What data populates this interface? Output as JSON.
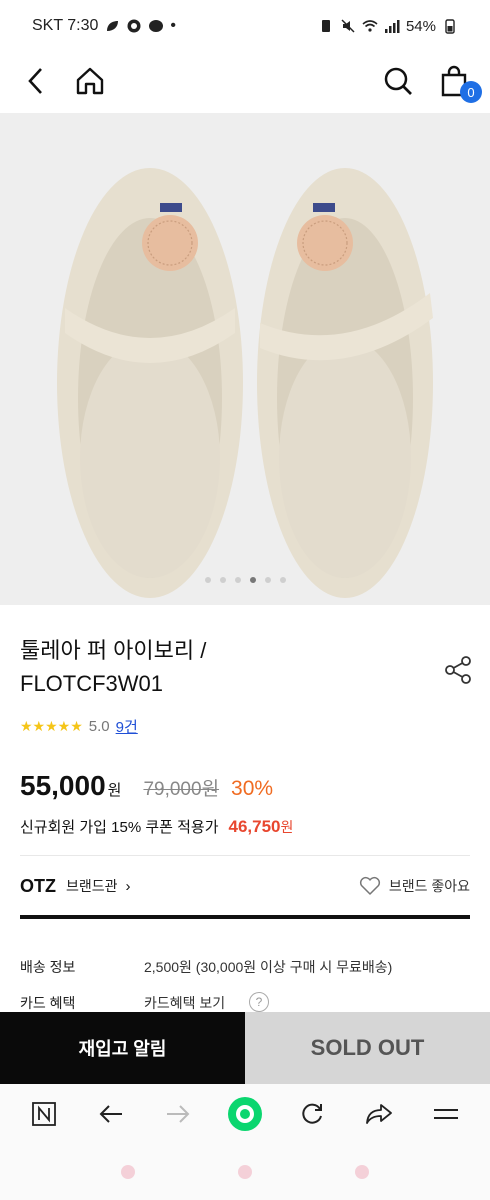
{
  "status_bar": {
    "carrier_time": "SKT 7:30",
    "dot": "•",
    "battery": "54%"
  },
  "header": {
    "cart_count": "0"
  },
  "gallery": {
    "total_images": 6,
    "active_index": 3
  },
  "product": {
    "title_line1": "툴레아 퍼 아이보리 /",
    "title_line2": "FLOTCF3W01",
    "stars": "★★★★★",
    "rating": "5.0",
    "review_count": "9건",
    "price": "55,000",
    "price_unit": "원",
    "original_price": "79,000원",
    "discount": "30%",
    "coupon_text": "신규회원 가입 15% 쿠폰 적용가",
    "coupon_price": "46,750",
    "coupon_unit": "원"
  },
  "brand": {
    "name": "OTZ",
    "shop_label": "브랜드관",
    "arrow": "›",
    "like_label": "브랜드 좋아요"
  },
  "info": [
    {
      "label": "배송 정보",
      "value": "2,500원 (30,000원 이상 구매 시 무료배송)"
    },
    {
      "label": "카드 혜택",
      "value": "카드혜택 보기"
    }
  ],
  "actions": {
    "restock_label": "재입고 알림",
    "soldout_label": "SOLD OUT"
  },
  "colors": {
    "accent_blue": "#1f6fe5",
    "discount_orange": "#f06b21",
    "coupon_red": "#e8472f",
    "star_yellow": "#f5c518"
  }
}
